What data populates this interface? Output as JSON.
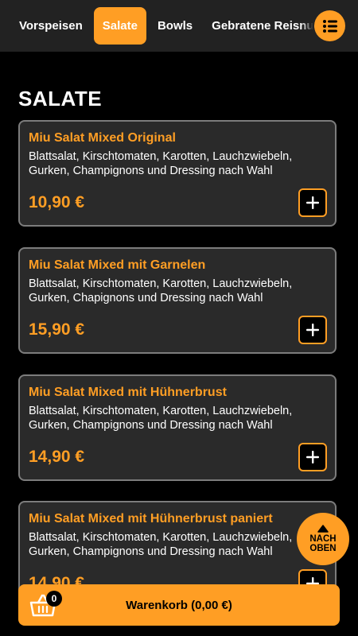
{
  "nav": {
    "tabs": [
      {
        "label": "Vorspeisen",
        "active": false
      },
      {
        "label": "Salate",
        "active": true
      },
      {
        "label": "Bowls",
        "active": false
      },
      {
        "label": "Gebratene Reisnudeln",
        "active": false
      }
    ],
    "menu_icon": "list-icon"
  },
  "section": {
    "title": "SALATE"
  },
  "items": [
    {
      "name": "Miu Salat Mixed Original",
      "description": "Blattsalat, Kirschtomaten, Karotten, Lauchzwiebeln, Gurken, Champignons und Dressing nach Wahl",
      "price": "10,90 €",
      "add_icon": "plus-icon"
    },
    {
      "name": "Miu Salat Mixed mit Garnelen",
      "description": "Blattsalat, Kirschtomaten, Karotten, Lauchzwiebeln, Gurken, Chapignons und Dressing nach Wahl",
      "price": "15,90 €",
      "add_icon": "plus-icon"
    },
    {
      "name": "Miu Salat Mixed mit Hühnerbrust",
      "description": "Blattsalat, Kirschtomaten, Karotten, Lauchzwiebeln, Gurken, Champignons und Dressing nach Wahl",
      "price": "14,90 €",
      "add_icon": "plus-icon"
    },
    {
      "name": "Miu Salat Mixed mit Hühnerbrust paniert",
      "description": "Blattsalat, Kirschtomaten, Karotten, Lauchzwiebeln, Gurken, Champignons und Dressing nach Wahl",
      "price": "14,90 €",
      "add_icon": "plus-icon"
    }
  ],
  "back_to_top": {
    "line1": "NACH",
    "line2": "OBEN",
    "icon": "arrow-up-icon"
  },
  "cart": {
    "label": "Warenkorb (0,00 €)",
    "count": "0",
    "icon": "basket-icon"
  },
  "colors": {
    "accent": "#ff9e24",
    "background": "#000000",
    "card": "#2a2a2a",
    "card_border": "#7c7c7c",
    "topbar": "#222222"
  }
}
